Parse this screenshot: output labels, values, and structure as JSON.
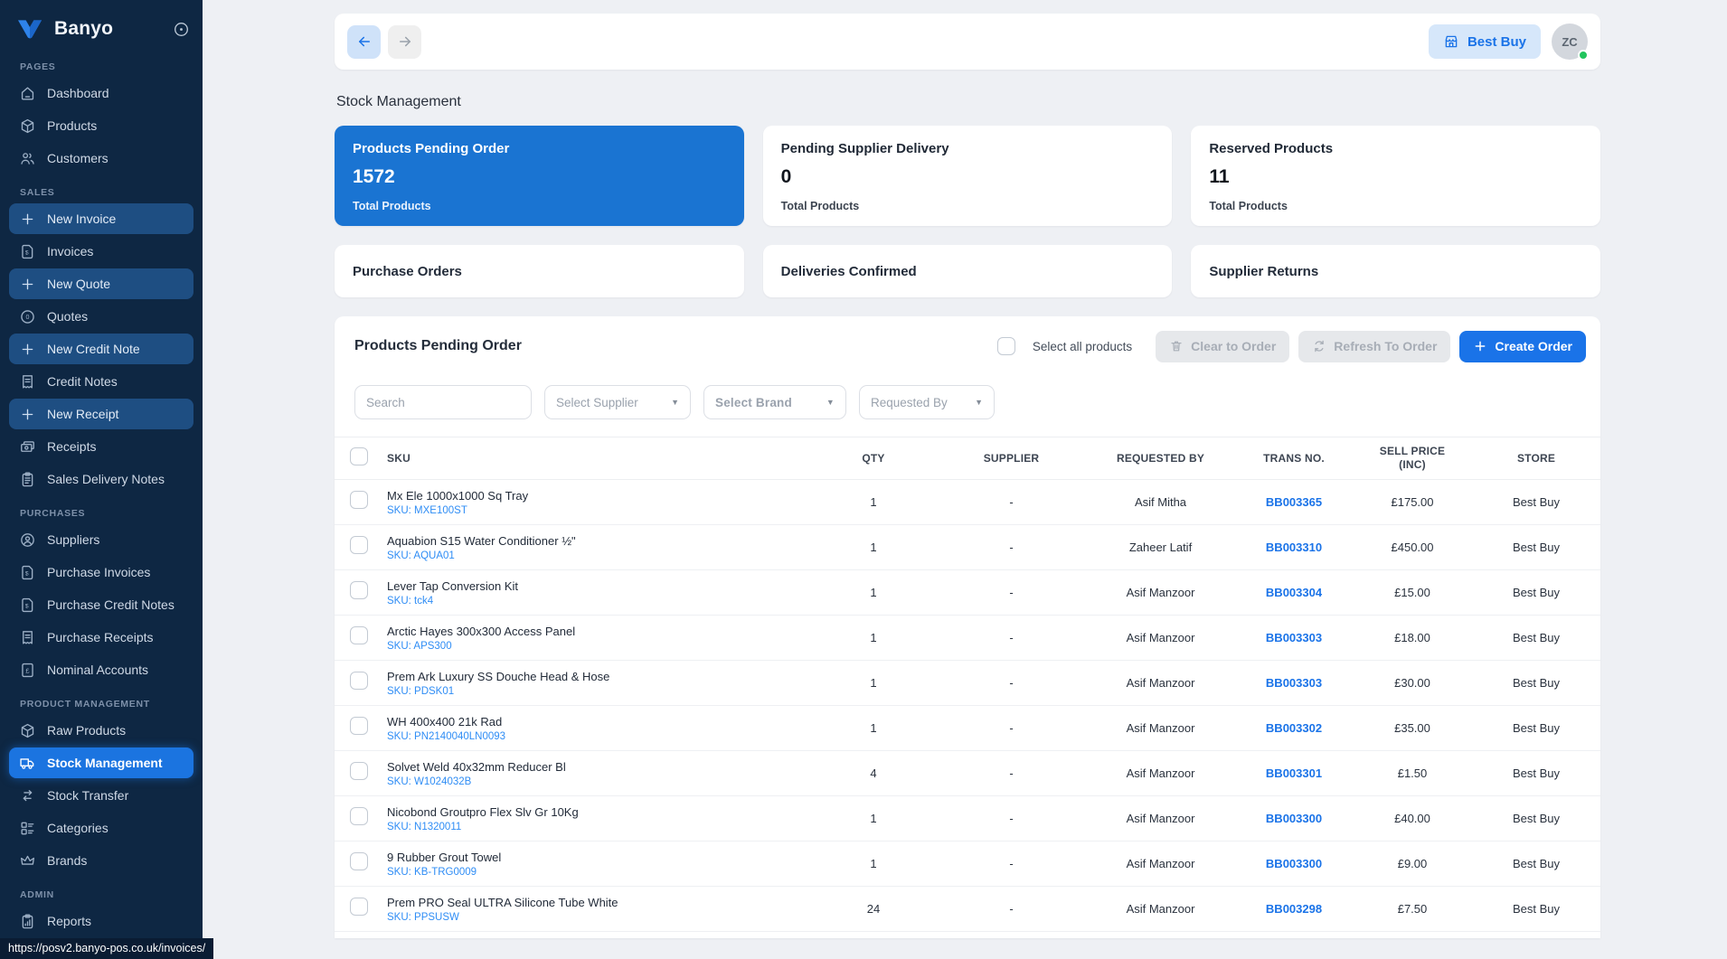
{
  "colors": {
    "accent": "#1a73e8",
    "stat_active": "#1a74d2",
    "sidebar_bg": "#0e2743",
    "sidebar_active": "#1b74e0",
    "sidebar_new": "#1e4e82",
    "chip": "#d6e7fa",
    "success": "#21c45d",
    "main_bg": "#eef0f4"
  },
  "app": {
    "brand": "Banyo",
    "statusbar_url": "https://posv2.banyo-pos.co.uk/invoices/"
  },
  "sidebar": {
    "sections": [
      {
        "label": "PAGES",
        "items": [
          {
            "label": "Dashboard",
            "icon": "home",
            "style": ""
          },
          {
            "label": "Products",
            "icon": "box",
            "style": ""
          },
          {
            "label": "Customers",
            "icon": "users",
            "style": ""
          }
        ]
      },
      {
        "label": "SALES",
        "items": [
          {
            "label": "New Invoice",
            "icon": "plus",
            "style": "new"
          },
          {
            "label": "Invoices",
            "icon": "doc-dollar",
            "style": ""
          },
          {
            "label": "New Quote",
            "icon": "plus",
            "style": "new"
          },
          {
            "label": "Quotes",
            "icon": "quote-circle",
            "style": ""
          },
          {
            "label": "New Credit Note",
            "icon": "plus",
            "style": "new"
          },
          {
            "label": "Credit Notes",
            "icon": "receipt",
            "style": ""
          },
          {
            "label": "New Receipt",
            "icon": "plus",
            "style": "new"
          },
          {
            "label": "Receipts",
            "icon": "cash",
            "style": ""
          },
          {
            "label": "Sales Delivery Notes",
            "icon": "clipboard",
            "style": ""
          }
        ]
      },
      {
        "label": "PURCHASES",
        "items": [
          {
            "label": "Suppliers",
            "icon": "person-circle",
            "style": ""
          },
          {
            "label": "Purchase Invoices",
            "icon": "doc-dollar",
            "style": ""
          },
          {
            "label": "Purchase Credit Notes",
            "icon": "doc-dollar",
            "style": ""
          },
          {
            "label": "Purchase Receipts",
            "icon": "receipt",
            "style": ""
          },
          {
            "label": "Nominal Accounts",
            "icon": "pound-doc",
            "style": ""
          }
        ]
      },
      {
        "label": "PRODUCT MANAGEMENT",
        "items": [
          {
            "label": "Raw Products",
            "icon": "box",
            "style": ""
          },
          {
            "label": "Stock Management",
            "icon": "truck",
            "style": "active"
          },
          {
            "label": "Stock Transfer",
            "icon": "transfer",
            "style": ""
          },
          {
            "label": "Categories",
            "icon": "categories",
            "style": ""
          },
          {
            "label": "Brands",
            "icon": "crown",
            "style": ""
          }
        ]
      },
      {
        "label": "ADMIN",
        "items": [
          {
            "label": "Reports",
            "icon": "report",
            "style": ""
          }
        ]
      }
    ]
  },
  "topbar": {
    "store_button": "Best Buy",
    "avatar_initials": "ZC"
  },
  "page": {
    "title": "Stock Management"
  },
  "stat_cards": [
    {
      "title": "Products Pending Order",
      "value": "1572",
      "subtitle": "Total Products",
      "active": true
    },
    {
      "title": "Pending Supplier Delivery",
      "value": "0",
      "subtitle": "Total Products",
      "active": false
    },
    {
      "title": "Reserved Products",
      "value": "11",
      "subtitle": "Total Products",
      "active": false
    }
  ],
  "action_cards": [
    {
      "title": "Purchase Orders"
    },
    {
      "title": "Deliveries Confirmed"
    },
    {
      "title": "Supplier Returns"
    }
  ],
  "panel": {
    "title": "Products Pending Order",
    "select_all_label": "Select all products",
    "buttons": {
      "clear": "Clear to Order",
      "refresh": "Refresh To Order",
      "create": "Create Order"
    },
    "filters": {
      "search_placeholder": "Search",
      "supplier": "Select Supplier",
      "brand": "Select Brand",
      "requested_by": "Requested By"
    }
  },
  "table": {
    "columns": [
      "SKU",
      "QTY",
      "SUPPLIER",
      "REQUESTED BY",
      "TRANS NO.",
      "SELL PRICE (INC)",
      "STORE"
    ],
    "sku_prefix": "SKU:",
    "rows": [
      {
        "name": "Mx Ele 1000x1000 Sq Tray",
        "sku": "MXE100ST",
        "qty": "1",
        "supplier": "-",
        "requested_by": "Asif Mitha",
        "trans_no": "BB003365",
        "price": "£175.00",
        "store": "Best Buy"
      },
      {
        "name": "Aquabion S15 Water Conditioner ½\"",
        "sku": "AQUA01",
        "qty": "1",
        "supplier": "-",
        "requested_by": "Zaheer Latif",
        "trans_no": "BB003310",
        "price": "£450.00",
        "store": "Best Buy"
      },
      {
        "name": "Lever Tap Conversion Kit",
        "sku": "tck4",
        "qty": "1",
        "supplier": "-",
        "requested_by": "Asif Manzoor",
        "trans_no": "BB003304",
        "price": "£15.00",
        "store": "Best Buy"
      },
      {
        "name": "Arctic Hayes 300x300 Access Panel",
        "sku": "APS300",
        "qty": "1",
        "supplier": "-",
        "requested_by": "Asif Manzoor",
        "trans_no": "BB003303",
        "price": "£18.00",
        "store": "Best Buy"
      },
      {
        "name": "Prem Ark Luxury SS Douche Head & Hose",
        "sku": "PDSK01",
        "qty": "1",
        "supplier": "-",
        "requested_by": "Asif Manzoor",
        "trans_no": "BB003303",
        "price": "£30.00",
        "store": "Best Buy"
      },
      {
        "name": "WH 400x400 21k Rad",
        "sku": "PN2140040LN0093",
        "qty": "1",
        "supplier": "-",
        "requested_by": "Asif Manzoor",
        "trans_no": "BB003302",
        "price": "£35.00",
        "store": "Best Buy"
      },
      {
        "name": "Solvet Weld 40x32mm Reducer Bl",
        "sku": "W1024032B",
        "qty": "4",
        "supplier": "-",
        "requested_by": "Asif Manzoor",
        "trans_no": "BB003301",
        "price": "£1.50",
        "store": "Best Buy"
      },
      {
        "name": "Nicobond Groutpro Flex Slv Gr 10Kg",
        "sku": "N1320011",
        "qty": "1",
        "supplier": "-",
        "requested_by": "Asif Manzoor",
        "trans_no": "BB003300",
        "price": "£40.00",
        "store": "Best Buy"
      },
      {
        "name": "9 Rubber Grout Towel",
        "sku": "KB-TRG0009",
        "qty": "1",
        "supplier": "-",
        "requested_by": "Asif Manzoor",
        "trans_no": "BB003300",
        "price": "£9.00",
        "store": "Best Buy"
      },
      {
        "name": "Prem PRO Seal ULTRA Silicone Tube White",
        "sku": "PPSUSW",
        "qty": "24",
        "supplier": "-",
        "requested_by": "Asif Manzoor",
        "trans_no": "BB003298",
        "price": "£7.50",
        "store": "Best Buy"
      }
    ]
  }
}
